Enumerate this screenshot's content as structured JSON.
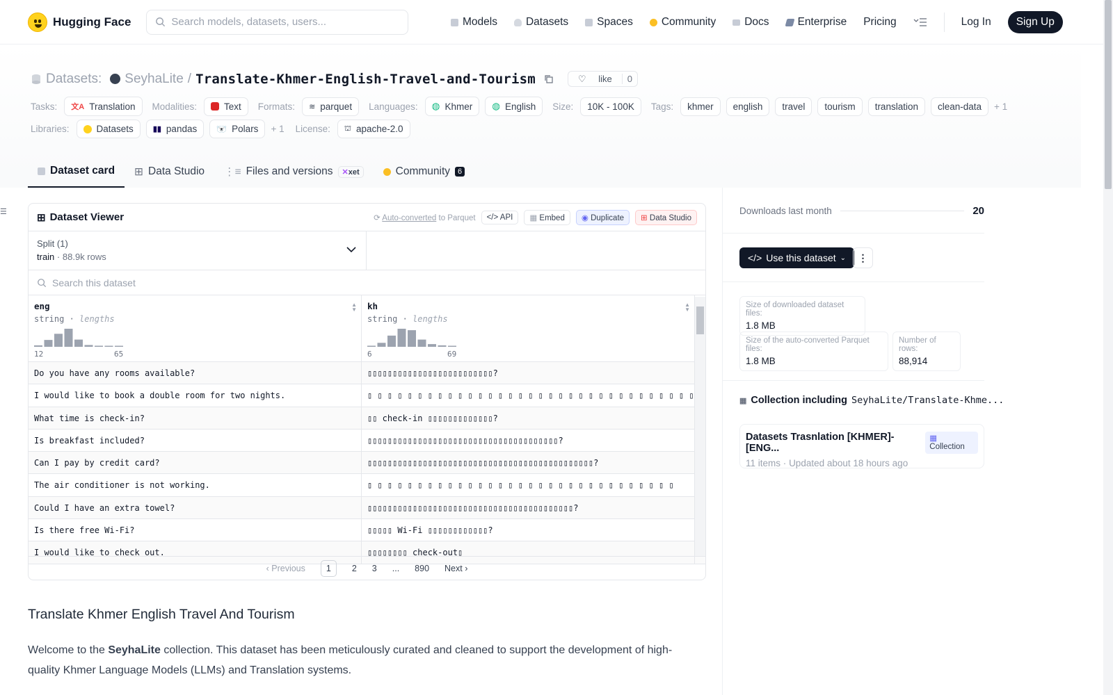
{
  "nav": {
    "brand": "Hugging Face",
    "search_placeholder": "Search models, datasets, users...",
    "links": [
      "Models",
      "Datasets",
      "Spaces",
      "Community",
      "Docs",
      "Enterprise",
      "Pricing"
    ],
    "login": "Log In",
    "signup": "Sign Up"
  },
  "header": {
    "section": "Datasets:",
    "owner": "SeyhaLite",
    "sep": "/",
    "repo": "Translate-Khmer-English-Travel-and-Tourism",
    "like_label": "like",
    "like_count": "0",
    "tasks_label": "Tasks:",
    "tasks": [
      "Translation"
    ],
    "modalities_label": "Modalities:",
    "modalities": [
      "Text"
    ],
    "formats_label": "Formats:",
    "formats": [
      "parquet"
    ],
    "languages_label": "Languages:",
    "languages": [
      "Khmer",
      "English"
    ],
    "size_label": "Size:",
    "size": "10K - 100K",
    "tags_label": "Tags:",
    "tags": [
      "khmer",
      "english",
      "travel",
      "tourism",
      "translation",
      "clean-data"
    ],
    "tags_more": "+ 1",
    "libraries_label": "Libraries:",
    "libraries": [
      "Datasets",
      "pandas",
      "Polars"
    ],
    "libraries_more": "+ 1",
    "license_label": "License:",
    "license": "apache-2.0"
  },
  "tabs": {
    "card": "Dataset card",
    "studio": "Data Studio",
    "files": "Files and versions",
    "xet": "xet",
    "community": "Community",
    "community_count": "6"
  },
  "viewer": {
    "title": "Dataset Viewer",
    "auto": "Auto-converted",
    "auto_to": "to Parquet",
    "api": "API",
    "embed": "Embed",
    "duplicate": "Duplicate",
    "data_studio": "Data Studio",
    "split_label": "Split (1)",
    "split_name": "train",
    "split_dot": "·",
    "split_rows": "88.9k rows",
    "search_placeholder": "Search this dataset",
    "columns": [
      {
        "name": "eng",
        "type": "string",
        "lengths": "lengths",
        "min": "12",
        "max": "65",
        "hist": [
          0.08,
          0.38,
          0.72,
          1.0,
          0.4,
          0.1,
          0.06,
          0.05,
          0.04
        ]
      },
      {
        "name": "kh",
        "type": "string",
        "lengths": "lengths",
        "min": "6",
        "max": "69",
        "hist": [
          0.06,
          0.22,
          0.62,
          1.0,
          0.92,
          0.4,
          0.15,
          0.08,
          0.05
        ]
      }
    ],
    "rows": [
      [
        "Do you have any rooms available?",
        "▯▯▯▯▯▯▯▯▯▯▯▯▯▯▯▯▯▯▯▯▯▯▯▯▯?"
      ],
      [
        "I would like to book a double room for two nights.",
        "▯ ▯ ▯ ▯ ▯ ▯ ▯ ▯ ▯ ▯ ▯ ▯ ▯ ▯ ▯ ▯ ▯ ▯ ▯ ▯ ▯ ▯ ▯ ▯ ▯ ▯ ▯ ▯ ▯ ▯ ▯ ▯ ▯ ▯ ▯ ▯ ▯ ▯ ▯ ▯ ▯ ▯ ▯"
      ],
      [
        "What time is check-in?",
        "▯▯ check-in ▯▯▯▯▯▯▯▯▯▯▯▯▯?"
      ],
      [
        "Is breakfast included?",
        "▯▯▯▯▯▯▯▯▯▯▯▯▯▯▯▯▯▯▯▯▯▯▯▯▯▯▯▯▯▯▯▯▯▯▯▯▯▯?"
      ],
      [
        "Can I pay by credit card?",
        "▯▯▯▯▯▯▯▯▯▯▯▯▯▯▯▯▯▯▯▯▯▯▯▯▯▯▯▯▯▯▯▯▯▯▯▯▯▯▯▯▯▯▯▯▯?"
      ],
      [
        "The air conditioner is not working.",
        "▯ ▯ ▯ ▯ ▯ ▯ ▯ ▯ ▯ ▯ ▯ ▯ ▯ ▯ ▯ ▯ ▯ ▯ ▯ ▯ ▯ ▯ ▯ ▯ ▯ ▯ ▯ ▯ ▯ ▯ ▯"
      ],
      [
        "Could I have an extra towel?",
        "▯▯▯▯▯▯▯▯▯▯▯▯▯▯▯▯▯▯▯▯▯▯▯▯▯▯▯▯▯▯▯▯▯▯▯▯▯▯▯▯▯?"
      ],
      [
        "Is there free Wi-Fi?",
        "▯▯▯▯▯ Wi-Fi ▯▯▯▯▯▯▯▯▯▯▯▯?"
      ],
      [
        "I would like to check out.",
        "▯▯▯▯▯▯▯▯ check-out▯"
      ]
    ],
    "pager": {
      "prev": "Previous",
      "p1": "1",
      "p2": "2",
      "p3": "3",
      "ellipsis": "...",
      "last": "890",
      "next": "Next"
    }
  },
  "doc": {
    "title": "Translate Khmer English Travel And Tourism",
    "p_before": "Welcome to the ",
    "p_bold": "SeyhaLite",
    "p_after": " collection. This dataset has been meticulously curated and cleaned to support the development of high-quality Khmer Language Models (LLMs) and Translation systems."
  },
  "sidebar": {
    "downloads_label": "Downloads last month",
    "downloads_value": "20",
    "use_button": "Use this dataset",
    "size_dl_label": "Size of downloaded dataset files:",
    "size_dl_value": "1.8 MB",
    "size_parquet_label": "Size of the auto-converted Parquet files:",
    "size_parquet_value": "1.8 MB",
    "rows_label": "Number of rows:",
    "rows_value": "88,914",
    "collection_heading": "Collection including",
    "collection_path": "SeyhaLite/Translate-Khme...",
    "collection_title": "Datasets Trasnlation [KHMER]-[ENG...",
    "collection_tag": "Collection",
    "collection_items": "11 items",
    "collection_dot": "·",
    "collection_updated": "Updated about 18 hours ago"
  },
  "colors": {
    "accent": "#111827",
    "brand_yellow": "#ffd21e",
    "muted": "#9ca3af",
    "border": "#e5e7eb",
    "hist_bar": "#9ca3af"
  }
}
